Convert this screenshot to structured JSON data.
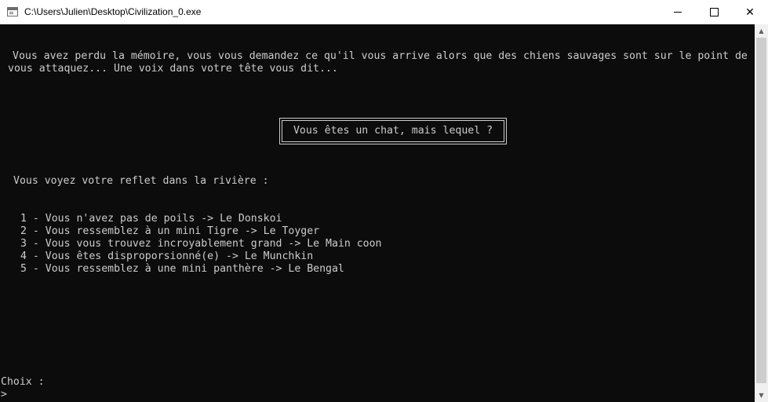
{
  "window": {
    "title": "C:\\Users\\Julien\\Desktop\\Civilization_0.exe",
    "icons": {
      "app": "console-icon",
      "minimize": "minimize-icon",
      "maximize": "maximize-icon",
      "close": "close-icon"
    },
    "close_glyph": "✕"
  },
  "console": {
    "intro_line1": "Vous avez perdu la mémoire, vous vous demandez ce qu'il vous arrive alors que des chiens sauvages sont sur le point de",
    "intro_line2": "vous attaquez... Une voix dans votre tête vous dit...",
    "question": "Vous êtes un chat, mais lequel ?",
    "reflection_prompt": "Vous voyez votre reflet dans la rivière :",
    "options": [
      "1 - Vous n'avez pas de poils -> Le Donskoi",
      "2 - Vous ressemblez à un mini Tigre -> Le Toyger",
      "3 - Vous vous trouvez incroyablement grand -> Le Main coon",
      "4 - Vous êtes disproporsionné(e) -> Le Munchkin",
      "5 - Vous ressemblez à une mini panthère -> Le Bengal"
    ],
    "choice_label": "Choix :",
    "input_prompt": ">"
  },
  "scrollbar": {
    "up_glyph": "▲",
    "down_glyph": "▼"
  },
  "colors": {
    "background": "#0c0c0c",
    "text": "#cccccc",
    "titlebar": "#ffffff",
    "scrollbar": "#f0f0f0"
  }
}
